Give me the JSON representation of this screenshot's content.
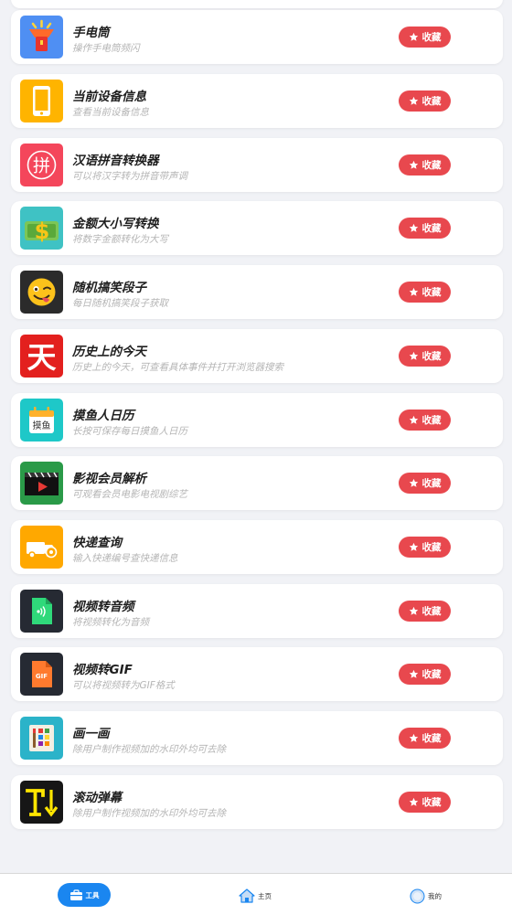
{
  "tools": [
    {
      "title": "手电筒",
      "desc": "操作手电筒频闪",
      "fav": "收藏",
      "icon": "flashlight-icon"
    },
    {
      "title": "当前设备信息",
      "desc": "查看当前设备信息",
      "fav": "收藏",
      "icon": "phone-icon"
    },
    {
      "title": "汉语拼音转换器",
      "desc": "可以将汉字转为拼音带声调",
      "fav": "收藏",
      "icon": "pinyin-icon"
    },
    {
      "title": "金额大小写转换",
      "desc": "将数字金额转化为大写",
      "fav": "收藏",
      "icon": "money-icon"
    },
    {
      "title": "随机搞笑段子",
      "desc": "每日随机搞笑段子获取",
      "fav": "收藏",
      "icon": "emoji-icon"
    },
    {
      "title": "历史上的今天",
      "desc": "历史上的今天，可查看具体事件并打开浏览器搜索",
      "fav": "收藏",
      "icon": "tian-icon"
    },
    {
      "title": "摸鱼人日历",
      "desc": "长按可保存每日摸鱼人日历",
      "fav": "收藏",
      "icon": "calendar-icon"
    },
    {
      "title": "影视会员解析",
      "desc": "可观看会员电影电视剧综艺",
      "fav": "收藏",
      "icon": "film-icon"
    },
    {
      "title": "快递查询",
      "desc": "输入快递编号查快递信息",
      "fav": "收藏",
      "icon": "truck-icon"
    },
    {
      "title": "视频转音频",
      "desc": "将视频转化为音频",
      "fav": "收藏",
      "icon": "audio-file-icon"
    },
    {
      "title": "视频转GIF",
      "desc": "可以将视频转为GIF格式",
      "fav": "收藏",
      "icon": "gif-file-icon"
    },
    {
      "title": "画一画",
      "desc": "除用户制作视频加的水印外均可去除",
      "fav": "收藏",
      "icon": "palette-icon"
    },
    {
      "title": "滚动弹幕",
      "desc": "除用户制作视频加的水印外均可去除",
      "fav": "收藏",
      "icon": "scroll-text-icon"
    }
  ],
  "tabbar": {
    "tools": "工具",
    "home": "主页",
    "mine": "我的"
  },
  "colors": {
    "accent": "#1a86f0",
    "favorite": "#e8484e",
    "background": "#f1f2f6"
  },
  "icon_text": {
    "pinyin": "拼",
    "tian": "天",
    "calendar": "摸鱼",
    "gif": "GIF"
  }
}
